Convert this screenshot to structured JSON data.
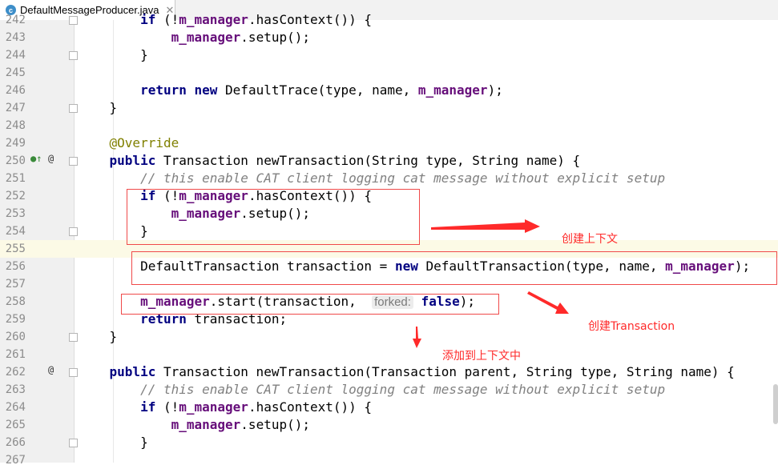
{
  "tab": {
    "icon_letter": "c",
    "filename": "DefaultMessageProducer.java",
    "close": "✕"
  },
  "lines": [
    {
      "n": "242",
      "code": "        if (!m_manager.hasContext()) {"
    },
    {
      "n": "243",
      "code": "            m_manager.setup();"
    },
    {
      "n": "244",
      "code": "        }"
    },
    {
      "n": "245",
      "code": ""
    },
    {
      "n": "246",
      "code": "        return new DefaultTrace(type, name, m_manager);"
    },
    {
      "n": "247",
      "code": "    }"
    },
    {
      "n": "248",
      "code": ""
    },
    {
      "n": "249",
      "code": "    @Override"
    },
    {
      "n": "250",
      "code": "    public Transaction newTransaction(String type, String name) {"
    },
    {
      "n": "251",
      "code": "        // this enable CAT client logging cat message without explicit setup"
    },
    {
      "n": "252",
      "code": "        if (!m_manager.hasContext()) {"
    },
    {
      "n": "253",
      "code": "            m_manager.setup();"
    },
    {
      "n": "254",
      "code": "        }"
    },
    {
      "n": "255",
      "code": ""
    },
    {
      "n": "256",
      "code": "        DefaultTransaction transaction = new DefaultTransaction(type, name, m_manager);"
    },
    {
      "n": "257",
      "code": ""
    },
    {
      "n": "258",
      "code": "        m_manager.start(transaction,  forked: false);"
    },
    {
      "n": "259",
      "code": "        return transaction;"
    },
    {
      "n": "260",
      "code": "    }"
    },
    {
      "n": "261",
      "code": ""
    },
    {
      "n": "262",
      "code": "    public Transaction newTransaction(Transaction parent, String type, String name) {"
    },
    {
      "n": "263",
      "code": "        // this enable CAT client logging cat message without explicit setup"
    },
    {
      "n": "264",
      "code": "        if (!m_manager.hasContext()) {"
    },
    {
      "n": "265",
      "code": "            m_manager.setup();"
    },
    {
      "n": "266",
      "code": "        }"
    },
    {
      "n": "267",
      "code": ""
    }
  ],
  "annotations": {
    "create_context": "创建上下文",
    "create_transaction": "创建Transaction",
    "add_to_context": "添加到上下文中"
  },
  "colors": {
    "keyword": "#000080",
    "field": "#660e7a",
    "annotation": "#808000",
    "comment": "#808080",
    "callout": "#ff2a2a"
  }
}
